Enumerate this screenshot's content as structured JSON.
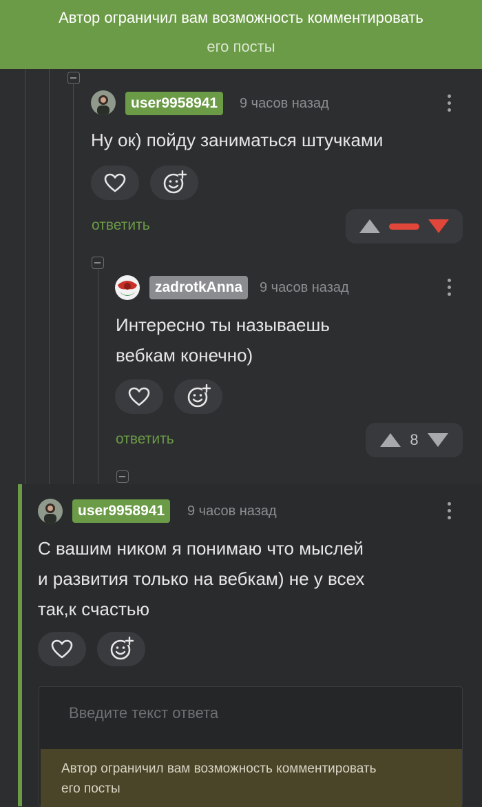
{
  "banner": {
    "line1": "Автор ограничил вам возможность комментировать",
    "line2": "его посты"
  },
  "comments": [
    {
      "user": "user9958941",
      "time": "9 часов назад",
      "text": [
        "Ну ок) пойду заниматься штучками"
      ],
      "reply_label": "ответить",
      "vote": {
        "state": "downvoted",
        "score": ""
      }
    },
    {
      "user": "zadrotkAnna",
      "time": "9 часов назад",
      "text": [
        "Интересно ты называешь",
        "вебкам конечно)"
      ],
      "reply_label": "ответить",
      "vote": {
        "state": "neutral",
        "score": "8"
      }
    },
    {
      "user": "user9958941",
      "time": "9 часов назад",
      "text": [
        "С вашим ником я понимаю что мыслей",
        "и развития только на вебкам) не у всех",
        "так,к счастью"
      ]
    }
  ],
  "reply_box": {
    "placeholder": "Введите текст ответа",
    "restriction_line1": "Автор ограничил вам возможность комментировать",
    "restriction_line2": "его посты"
  },
  "colors": {
    "accent": "#6b9b46",
    "downvote": "#e0473a",
    "background": "#2d2e30"
  },
  "icons": [
    "heart-icon",
    "smile-plus-icon",
    "more-vertical-icon",
    "collapse-icon",
    "upvote-icon",
    "downvote-icon"
  ]
}
